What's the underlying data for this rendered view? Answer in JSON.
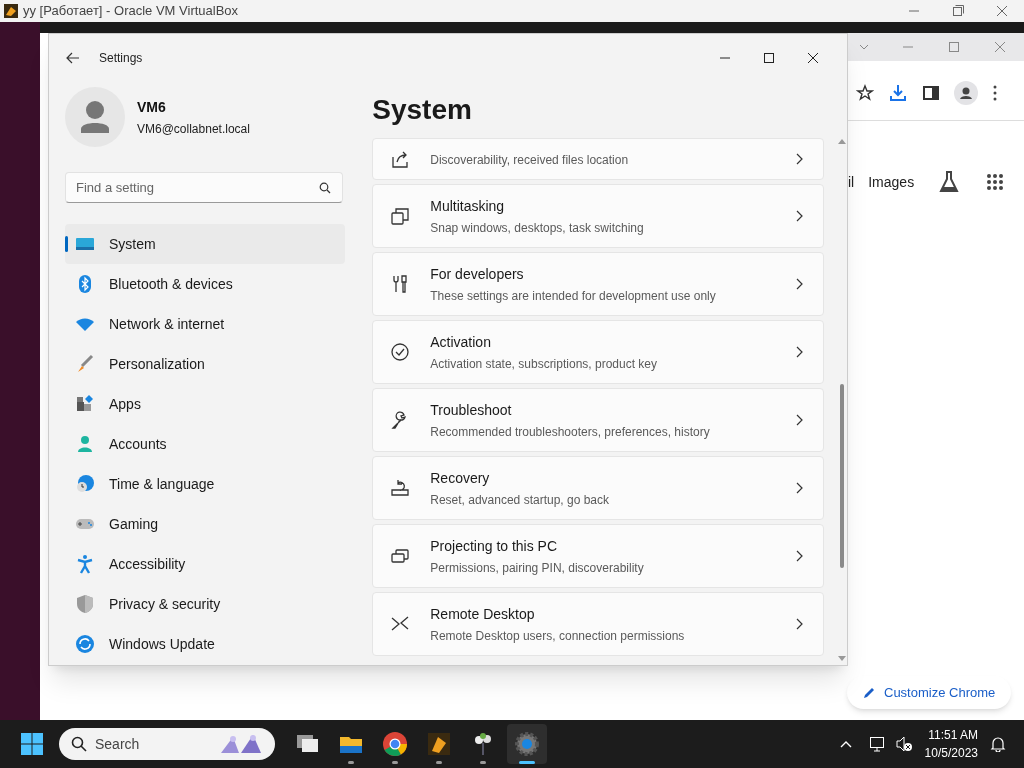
{
  "vm_window": {
    "title": "yy [Работает] - Oracle VM VirtualBox"
  },
  "browser": {
    "nav_links": [
      "il",
      "Images"
    ],
    "customize_button": "Customize Chrome"
  },
  "settings": {
    "title": "Settings",
    "user": {
      "name": "VM6",
      "email": "VM6@collabnet.local"
    },
    "search": {
      "placeholder": "Find a setting"
    },
    "nav": [
      {
        "label": "System",
        "selected": true
      },
      {
        "label": "Bluetooth & devices",
        "selected": false
      },
      {
        "label": "Network & internet",
        "selected": false
      },
      {
        "label": "Personalization",
        "selected": false
      },
      {
        "label": "Apps",
        "selected": false
      },
      {
        "label": "Accounts",
        "selected": false
      },
      {
        "label": "Time & language",
        "selected": false
      },
      {
        "label": "Gaming",
        "selected": false
      },
      {
        "label": "Accessibility",
        "selected": false
      },
      {
        "label": "Privacy & security",
        "selected": false
      },
      {
        "label": "Windows Update",
        "selected": false
      }
    ],
    "page_title": "System",
    "items": [
      {
        "description": "Discoverability, received files location"
      },
      {
        "title": "Multitasking",
        "description": "Snap windows, desktops, task switching"
      },
      {
        "title": "For developers",
        "description": "These settings are intended for development use only"
      },
      {
        "title": "Activation",
        "description": "Activation state, subscriptions, product key"
      },
      {
        "title": "Troubleshoot",
        "description": "Recommended troubleshooters, preferences, history"
      },
      {
        "title": "Recovery",
        "description": "Reset, advanced startup, go back"
      },
      {
        "title": "Projecting to this PC",
        "description": "Permissions, pairing PIN, discoverability"
      },
      {
        "title": "Remote Desktop",
        "description": "Remote Desktop users, connection permissions"
      }
    ]
  },
  "taskbar": {
    "search": {
      "placeholder": "Search"
    },
    "apps": [
      {
        "kind": "task-view",
        "running": false,
        "selected": false
      },
      {
        "kind": "folder",
        "running": true,
        "selected": false
      },
      {
        "kind": "chrome",
        "running": true,
        "selected": false
      },
      {
        "kind": "virtualbox",
        "running": true,
        "selected": false
      },
      {
        "kind": "plant",
        "running": true,
        "selected": false
      },
      {
        "kind": "settings",
        "running": true,
        "selected": true
      }
    ],
    "time": "11:51 AM",
    "date": "10/5/2023"
  }
}
